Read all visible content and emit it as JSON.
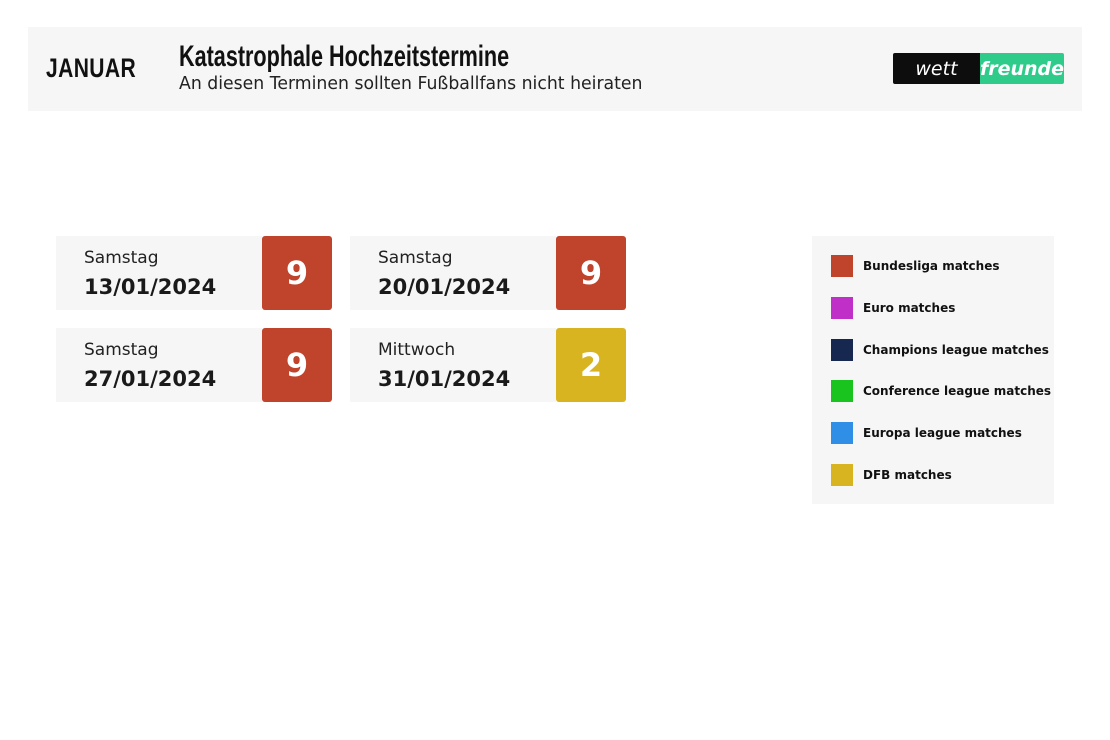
{
  "header": {
    "month": "JANUAR",
    "title": "Katastrophale Hochzeitstermine",
    "subtitle": "An diesen Terminen sollten Fußballfans nicht heiraten",
    "logo_left": "wett",
    "logo_right": "freunde"
  },
  "colors": {
    "bundesliga": "#c0432b",
    "euro": "#c02fc8",
    "champions": "#16284f",
    "conference": "#1ac41e",
    "europa": "#2f8fe6",
    "dfb": "#d8b421"
  },
  "dates": [
    {
      "weekday": "Samstag",
      "date": "13/01/2024",
      "count": "9",
      "color": "#c0432b"
    },
    {
      "weekday": "Samstag",
      "date": "20/01/2024",
      "count": "9",
      "color": "#c0432b"
    },
    {
      "weekday": "Samstag",
      "date": "27/01/2024",
      "count": "9",
      "color": "#c0432b"
    },
    {
      "weekday": "Mittwoch",
      "date": "31/01/2024",
      "count": "2",
      "color": "#d8b421"
    }
  ],
  "legend": [
    {
      "label": "Bundesliga matches",
      "color": "#c0432b"
    },
    {
      "label": "Euro matches",
      "color": "#c02fc8"
    },
    {
      "label": "Champions league matches",
      "color": "#16284f"
    },
    {
      "label": "Conference league matches",
      "color": "#1ac41e"
    },
    {
      "label": "Europa league matches",
      "color": "#2f8fe6"
    },
    {
      "label": "DFB matches",
      "color": "#d8b421"
    }
  ]
}
